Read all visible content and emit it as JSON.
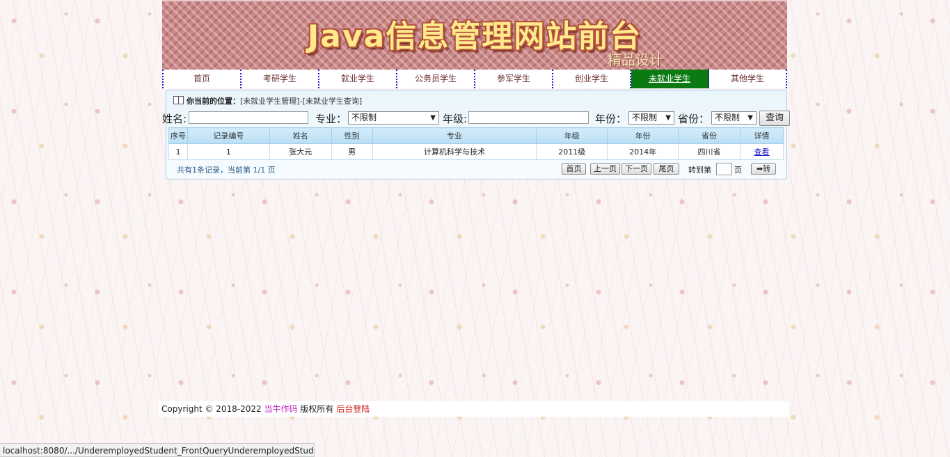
{
  "banner": {
    "title": "Java信息管理网站前台",
    "subtitle": "精品设计"
  },
  "nav": {
    "items": [
      {
        "label": "首页"
      },
      {
        "label": "考研学生"
      },
      {
        "label": "就业学生"
      },
      {
        "label": "公务员学生"
      },
      {
        "label": "参军学生"
      },
      {
        "label": "创业学生"
      },
      {
        "label": "未就业学生",
        "active": true
      },
      {
        "label": "其他学生"
      }
    ]
  },
  "location": {
    "prefix": "你当前的位置：",
    "path": "[未就业学生管理]-[未就业学生查询]"
  },
  "search": {
    "name_label": "姓名:",
    "name_value": "",
    "major_label": "专业：",
    "major_selected": "不限制",
    "grade_label": "年级:",
    "grade_value": "",
    "year_label": "年份：",
    "year_selected": "不限制",
    "province_label": "省份：",
    "province_selected": "不限制",
    "query_label": "查询"
  },
  "table": {
    "headers": [
      "序号",
      "记录编号",
      "姓名",
      "性别",
      "专业",
      "年级",
      "年份",
      "省份",
      "详情"
    ],
    "rows": [
      [
        "1",
        "1",
        "张大元",
        "男",
        "计算机科学与技术",
        "2011级",
        "2014年",
        "四川省",
        "查看"
      ]
    ]
  },
  "pager": {
    "info": "共有1条记录，当前第 1/1 页",
    "first": "首页",
    "prev": "上一页",
    "next": "下一页",
    "last": "尾页",
    "goto_label": "转到第",
    "goto_value": "",
    "page_unit": "页",
    "go_label": "➡转"
  },
  "footer": {
    "copyright": "Copyright © 2018-2022",
    "author": "当牛作码",
    "rights": "版权所有",
    "admin_link": "后台登陆"
  },
  "statusbar": {
    "url": "localhost:8080/.../UnderemployedStudent_FrontQueryUnderemployedStude..."
  }
}
